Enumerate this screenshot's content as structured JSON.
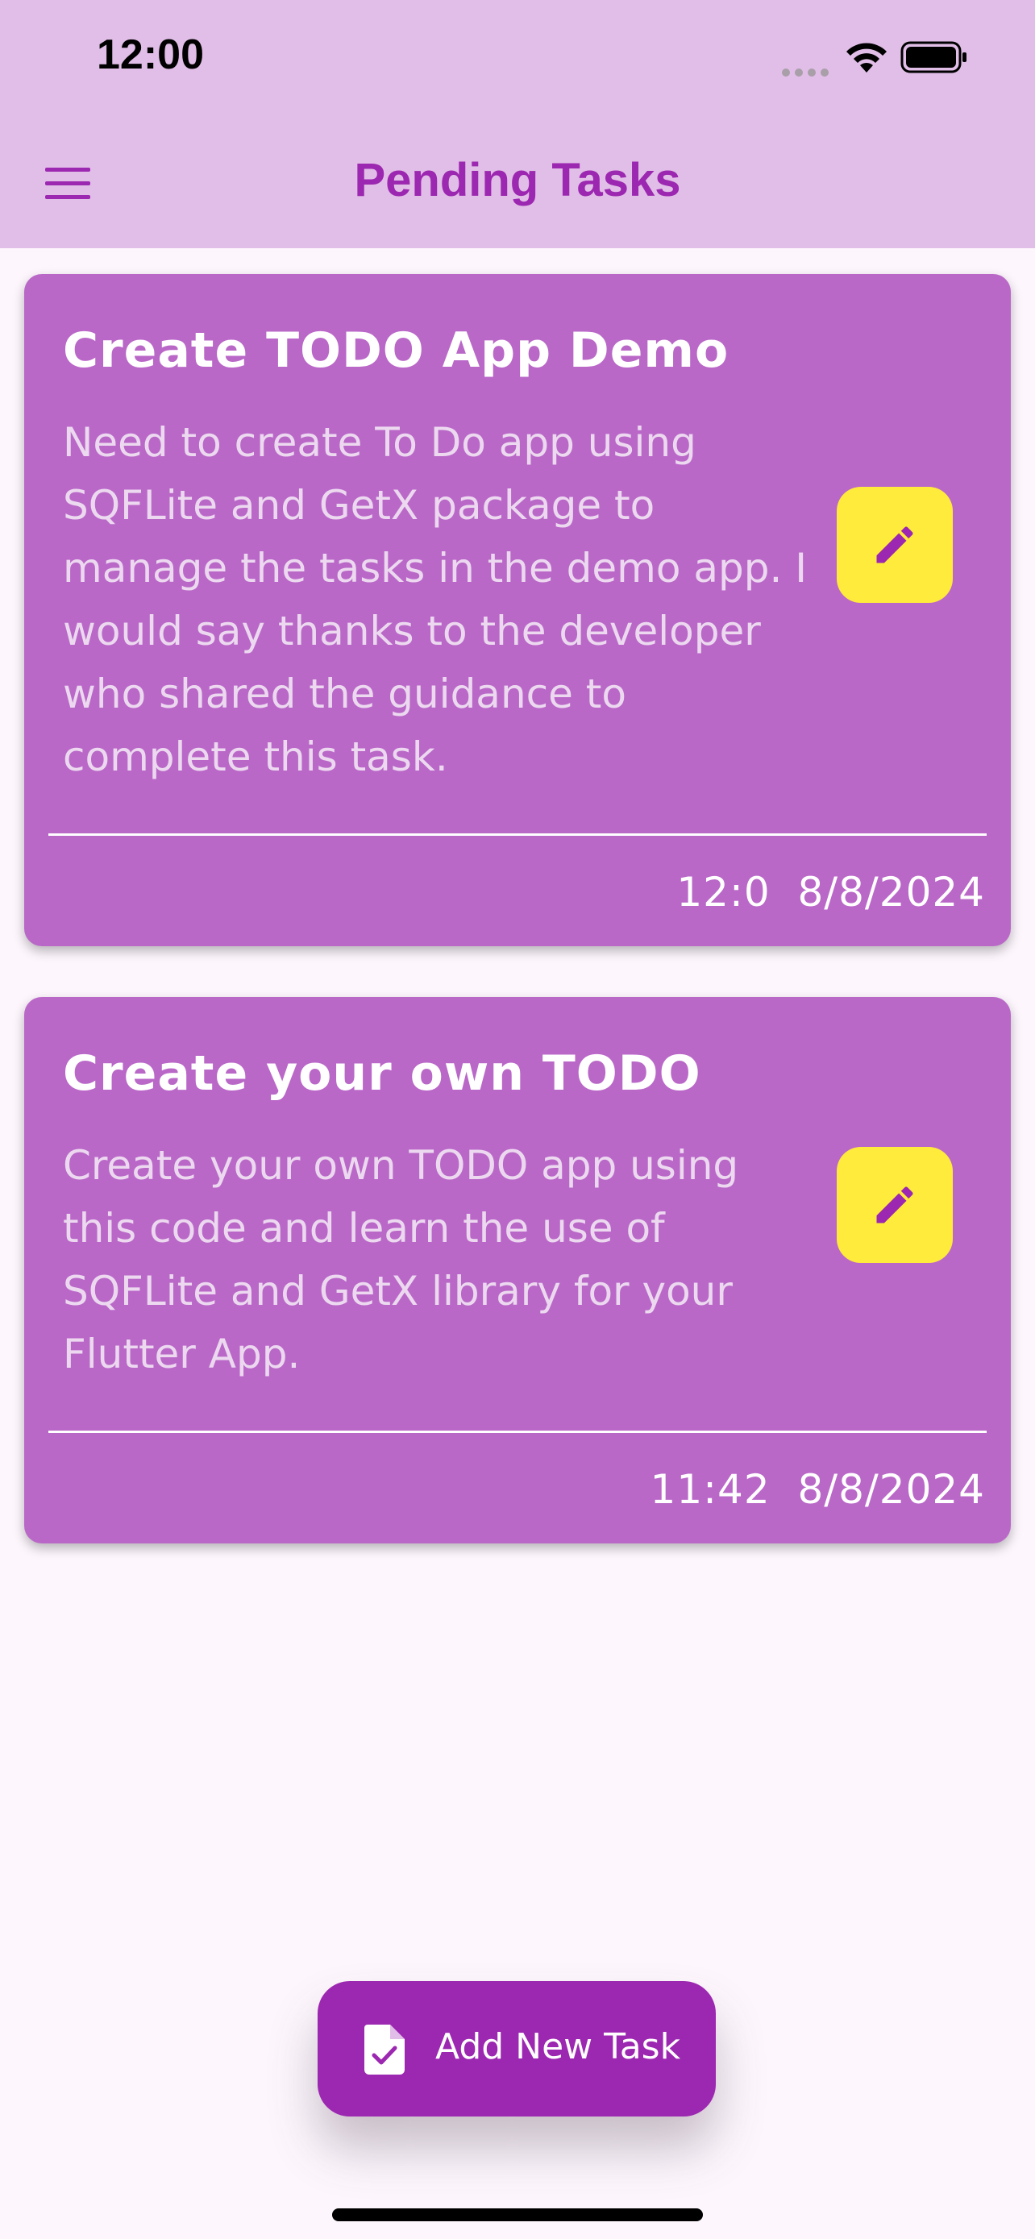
{
  "status_bar": {
    "time": "12:00"
  },
  "app_bar": {
    "title": "Pending Tasks",
    "menu_icon": "hamburger-menu-icon"
  },
  "tasks": [
    {
      "title": "Create TODO App Demo",
      "description": "Need to create To Do app using SQFLite and GetX package to manage the tasks in the demo app. I would say thanks to the developer who shared the guidance to complete this task.",
      "time": "12:0",
      "date": "8/8/2024",
      "edit_icon": "pencil-icon"
    },
    {
      "title": "Create your own TODO",
      "description": "Create your own TODO app using this code and learn the use of SQFLite and GetX library for your Flutter App.",
      "time": "11:42",
      "date": "8/8/2024",
      "edit_icon": "pencil-icon"
    }
  ],
  "fab": {
    "label": "Add New Task",
    "icon": "file-check-icon"
  },
  "colors": {
    "app_bar_bg": "#E1BEE7",
    "accent": "#9C27B0",
    "card_bg": "#BA68C8",
    "edit_button_bg": "#FFEB3B",
    "page_bg": "#FDF7FD"
  }
}
